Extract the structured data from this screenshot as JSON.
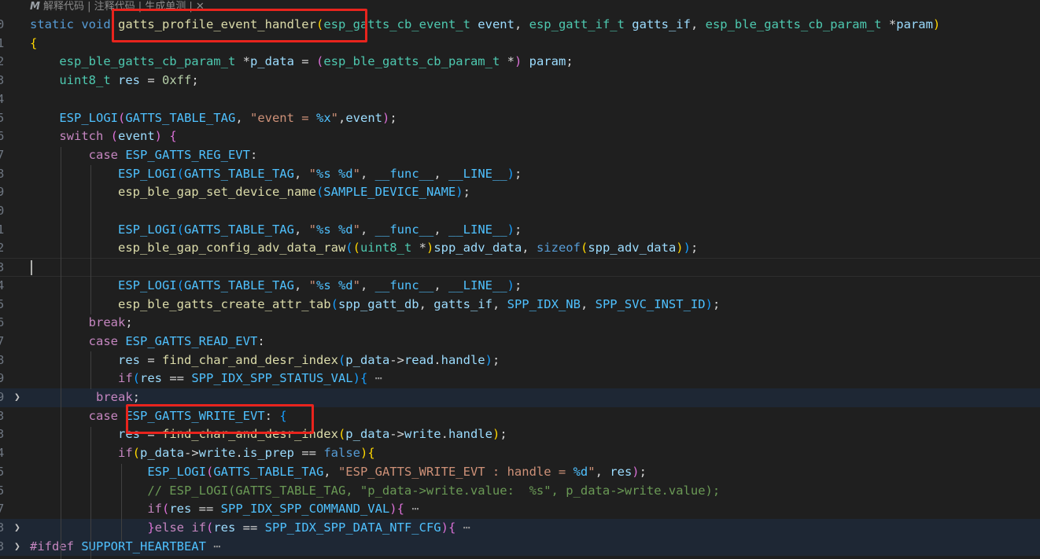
{
  "codelens": {
    "icon": "marscode-logo-icon",
    "text": "解释代码 | 注释代码 | 生成单测 | ✕"
  },
  "gutter": [
    "0",
    "1",
    "2",
    "3",
    "4",
    "5",
    "6",
    "7",
    "8",
    "9",
    "0",
    "1",
    "2",
    "3",
    "4",
    "5",
    "6",
    "7",
    "8",
    "9",
    "9",
    "3",
    "3",
    "4",
    "5",
    "5",
    "7",
    "3",
    "3",
    "9"
  ],
  "code": [
    [
      [
        "kw",
        "static "
      ],
      [
        "kw",
        "void "
      ],
      [
        "fn",
        "gatts_profile_event_handler"
      ],
      [
        "br1",
        "("
      ],
      [
        "ty",
        "esp_gatts_cb_event_t "
      ],
      [
        "var",
        "event"
      ],
      [
        "op",
        ", "
      ],
      [
        "ty",
        "esp_gatt_if_t "
      ],
      [
        "var",
        "gatts_if"
      ],
      [
        "op",
        ", "
      ],
      [
        "ty",
        "esp_ble_gatts_cb_param_t "
      ],
      [
        "op",
        "*"
      ],
      [
        "var",
        "param"
      ],
      [
        "br1",
        ")"
      ]
    ],
    [
      [
        "br1",
        "{"
      ]
    ],
    [
      [
        "op",
        "    "
      ],
      [
        "ty",
        "esp_ble_gatts_cb_param_t "
      ],
      [
        "op",
        "*"
      ],
      [
        "var",
        "p_data"
      ],
      [
        "op",
        " = "
      ],
      [
        "br2",
        "("
      ],
      [
        "ty",
        "esp_ble_gatts_cb_param_t "
      ],
      [
        "op",
        "*"
      ],
      [
        "br2",
        ")"
      ],
      [
        "op",
        " "
      ],
      [
        "var",
        "param"
      ],
      [
        "op",
        ";"
      ]
    ],
    [
      [
        "op",
        "    "
      ],
      [
        "ty",
        "uint8_t "
      ],
      [
        "var",
        "res"
      ],
      [
        "op",
        " = "
      ],
      [
        "num",
        "0xff"
      ],
      [
        "op",
        ";"
      ]
    ],
    [],
    [
      [
        "op",
        "    "
      ],
      [
        "mac",
        "ESP_LOGI"
      ],
      [
        "br2",
        "("
      ],
      [
        "mac",
        "GATTS_TABLE_TAG"
      ],
      [
        "op",
        ", "
      ],
      [
        "str",
        "\"event = "
      ],
      [
        "mac",
        "%x"
      ],
      [
        "str",
        "\""
      ],
      [
        "op",
        ","
      ],
      [
        "var",
        "event"
      ],
      [
        "br2",
        ")"
      ],
      [
        "op",
        ";"
      ]
    ],
    [
      [
        "op",
        "    "
      ],
      [
        "ctl",
        "switch "
      ],
      [
        "br2",
        "("
      ],
      [
        "var",
        "event"
      ],
      [
        "br2",
        ")"
      ],
      [
        "op",
        " "
      ],
      [
        "br2",
        "{"
      ]
    ],
    [
      [
        "op",
        "        "
      ],
      [
        "ctl",
        "case "
      ],
      [
        "mac",
        "ESP_GATTS_REG_EVT"
      ],
      [
        "op",
        ":"
      ]
    ],
    [
      [
        "op",
        "            "
      ],
      [
        "mac",
        "ESP_LOGI"
      ],
      [
        "br3",
        "("
      ],
      [
        "mac",
        "GATTS_TABLE_TAG"
      ],
      [
        "op",
        ", "
      ],
      [
        "str",
        "\""
      ],
      [
        "mac",
        "%s %d"
      ],
      [
        "str",
        "\""
      ],
      [
        "op",
        ", "
      ],
      [
        "mac",
        "__func__"
      ],
      [
        "op",
        ", "
      ],
      [
        "mac",
        "__LINE__"
      ],
      [
        "br3",
        ")"
      ],
      [
        "op",
        ";"
      ]
    ],
    [
      [
        "op",
        "            "
      ],
      [
        "fn",
        "esp_ble_gap_set_device_name"
      ],
      [
        "br3",
        "("
      ],
      [
        "mac",
        "SAMPLE_DEVICE_NAME"
      ],
      [
        "br3",
        ")"
      ],
      [
        "op",
        ";"
      ]
    ],
    [],
    [
      [
        "op",
        "            "
      ],
      [
        "mac",
        "ESP_LOGI"
      ],
      [
        "br3",
        "("
      ],
      [
        "mac",
        "GATTS_TABLE_TAG"
      ],
      [
        "op",
        ", "
      ],
      [
        "str",
        "\""
      ],
      [
        "mac",
        "%s %d"
      ],
      [
        "str",
        "\""
      ],
      [
        "op",
        ", "
      ],
      [
        "mac",
        "__func__"
      ],
      [
        "op",
        ", "
      ],
      [
        "mac",
        "__LINE__"
      ],
      [
        "br3",
        ")"
      ],
      [
        "op",
        ";"
      ]
    ],
    [
      [
        "op",
        "            "
      ],
      [
        "fn",
        "esp_ble_gap_config_adv_data_raw"
      ],
      [
        "br3",
        "("
      ],
      [
        "br1",
        "("
      ],
      [
        "ty",
        "uint8_t "
      ],
      [
        "op",
        "*"
      ],
      [
        "br1",
        ")"
      ],
      [
        "var",
        "spp_adv_data"
      ],
      [
        "op",
        ", "
      ],
      [
        "kw",
        "sizeof"
      ],
      [
        "br1",
        "("
      ],
      [
        "var",
        "spp_adv_data"
      ],
      [
        "br1",
        ")"
      ],
      [
        "br3",
        ")"
      ],
      [
        "op",
        ";"
      ]
    ],
    [],
    [
      [
        "op",
        "            "
      ],
      [
        "mac",
        "ESP_LOGI"
      ],
      [
        "br3",
        "("
      ],
      [
        "mac",
        "GATTS_TABLE_TAG"
      ],
      [
        "op",
        ", "
      ],
      [
        "str",
        "\""
      ],
      [
        "mac",
        "%s %d"
      ],
      [
        "str",
        "\""
      ],
      [
        "op",
        ", "
      ],
      [
        "mac",
        "__func__"
      ],
      [
        "op",
        ", "
      ],
      [
        "mac",
        "__LINE__"
      ],
      [
        "br3",
        ")"
      ],
      [
        "op",
        ";"
      ]
    ],
    [
      [
        "op",
        "            "
      ],
      [
        "fn",
        "esp_ble_gatts_create_attr_tab"
      ],
      [
        "br3",
        "("
      ],
      [
        "var",
        "spp_gatt_db"
      ],
      [
        "op",
        ", "
      ],
      [
        "var",
        "gatts_if"
      ],
      [
        "op",
        ", "
      ],
      [
        "mac",
        "SPP_IDX_NB"
      ],
      [
        "op",
        ", "
      ],
      [
        "mac",
        "SPP_SVC_INST_ID"
      ],
      [
        "br3",
        ")"
      ],
      [
        "op",
        ";"
      ]
    ],
    [
      [
        "op",
        "        "
      ],
      [
        "ctl",
        "break"
      ],
      [
        "op",
        ";"
      ]
    ],
    [
      [
        "op",
        "        "
      ],
      [
        "ctl",
        "case "
      ],
      [
        "mac",
        "ESP_GATTS_READ_EVT"
      ],
      [
        "op",
        ":"
      ]
    ],
    [
      [
        "op",
        "            "
      ],
      [
        "var",
        "res"
      ],
      [
        "op",
        " = "
      ],
      [
        "fn",
        "find_char_and_desr_index"
      ],
      [
        "br3",
        "("
      ],
      [
        "var",
        "p_data"
      ],
      [
        "op",
        "->"
      ],
      [
        "var",
        "read"
      ],
      [
        "op",
        "."
      ],
      [
        "var",
        "handle"
      ],
      [
        "br3",
        ")"
      ],
      [
        "op",
        ";"
      ]
    ],
    [
      [
        "op",
        "            "
      ],
      [
        "ctl",
        "if"
      ],
      [
        "br3",
        "("
      ],
      [
        "var",
        "res"
      ],
      [
        "op",
        " == "
      ],
      [
        "mac",
        "SPP_IDX_SPP_STATUS_VAL"
      ],
      [
        "br3",
        ")"
      ],
      [
        "br3",
        "{"
      ],
      [
        "ell",
        " ⋯"
      ]
    ],
    [
      [
        "op",
        "         "
      ],
      [
        "ctl",
        "break"
      ],
      [
        "op",
        ";"
      ]
    ],
    [
      [
        "op",
        "        "
      ],
      [
        "ctl",
        "case "
      ],
      [
        "mac",
        "ESP_GATTS_WRITE_EVT"
      ],
      [
        "op",
        ": "
      ],
      [
        "br3",
        "{"
      ]
    ],
    [
      [
        "op",
        "            "
      ],
      [
        "var",
        "res"
      ],
      [
        "op",
        " = "
      ],
      [
        "fn",
        "find_char_and_desr_index"
      ],
      [
        "br1",
        "("
      ],
      [
        "var",
        "p_data"
      ],
      [
        "op",
        "->"
      ],
      [
        "var",
        "write"
      ],
      [
        "op",
        "."
      ],
      [
        "var",
        "handle"
      ],
      [
        "br1",
        ")"
      ],
      [
        "op",
        ";"
      ]
    ],
    [
      [
        "op",
        "            "
      ],
      [
        "ctl",
        "if"
      ],
      [
        "br1",
        "("
      ],
      [
        "var",
        "p_data"
      ],
      [
        "op",
        "->"
      ],
      [
        "var",
        "write"
      ],
      [
        "op",
        "."
      ],
      [
        "var",
        "is_prep"
      ],
      [
        "op",
        " == "
      ],
      [
        "kw",
        "false"
      ],
      [
        "br1",
        ")"
      ],
      [
        "br1",
        "{"
      ]
    ],
    [
      [
        "op",
        "                "
      ],
      [
        "mac",
        "ESP_LOGI"
      ],
      [
        "br2",
        "("
      ],
      [
        "mac",
        "GATTS_TABLE_TAG"
      ],
      [
        "op",
        ", "
      ],
      [
        "str",
        "\"ESP_GATTS_WRITE_EVT : handle = "
      ],
      [
        "mac",
        "%d"
      ],
      [
        "str",
        "\""
      ],
      [
        "op",
        ", "
      ],
      [
        "var",
        "res"
      ],
      [
        "br2",
        ")"
      ],
      [
        "op",
        ";"
      ]
    ],
    [
      [
        "op",
        "                "
      ],
      [
        "com",
        "// ESP_LOGI(GATTS_TABLE_TAG, \"p_data->write.value:  %s\", p_data->write.value);"
      ]
    ],
    [
      [
        "op",
        "                "
      ],
      [
        "ctl",
        "if"
      ],
      [
        "br2",
        "("
      ],
      [
        "var",
        "res"
      ],
      [
        "op",
        " == "
      ],
      [
        "mac",
        "SPP_IDX_SPP_COMMAND_VAL"
      ],
      [
        "br2",
        ")"
      ],
      [
        "br2",
        "{"
      ],
      [
        "ell",
        " ⋯"
      ]
    ],
    [
      [
        "op",
        "                "
      ],
      [
        "br2",
        "}"
      ],
      [
        "ctl",
        "else "
      ],
      [
        "ctl",
        "if"
      ],
      [
        "br2",
        "("
      ],
      [
        "var",
        "res"
      ],
      [
        "op",
        " == "
      ],
      [
        "mac",
        "SPP_IDX_SPP_DATA_NTF_CFG"
      ],
      [
        "br2",
        ")"
      ],
      [
        "br2",
        "{"
      ],
      [
        "ell",
        " ⋯"
      ]
    ],
    [
      [
        "pp",
        "#ifdef "
      ],
      [
        "mac",
        "SUPPORT_HEARTBEAT"
      ],
      [
        "ell",
        " ⋯"
      ]
    ]
  ]
}
